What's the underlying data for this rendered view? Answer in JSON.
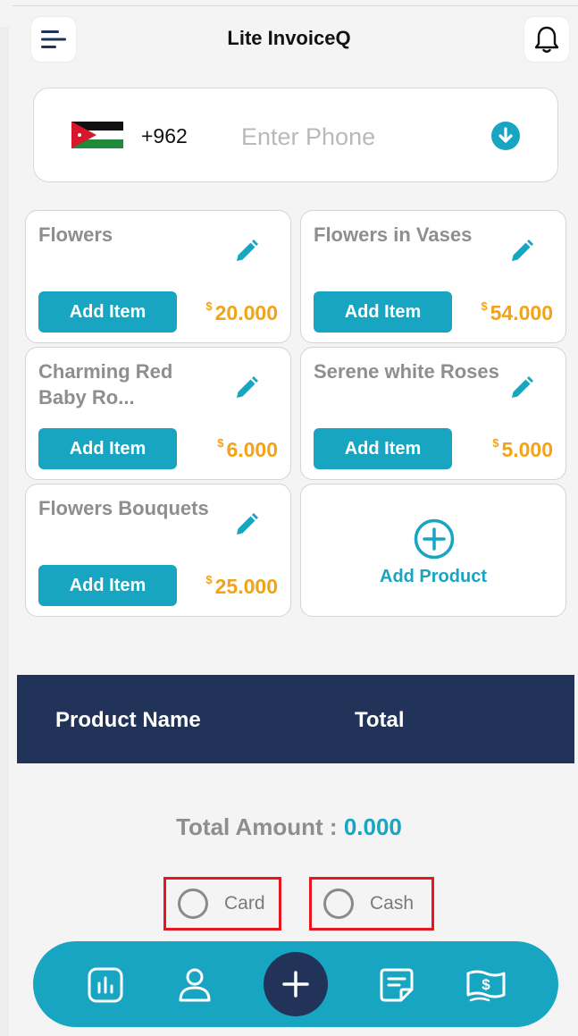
{
  "header": {
    "title": "Lite InvoiceQ",
    "menu_icon": "menu-icon",
    "bell_icon": "bell-icon"
  },
  "phone": {
    "country_code": "+962",
    "placeholder": "Enter Phone",
    "value": "",
    "flag": "jordan-flag",
    "dropdown_icon": "arrow-down-circle-icon"
  },
  "products": [
    {
      "name": "Flowers",
      "price": "20.000",
      "currency_symbol": "$",
      "button": "Add Item"
    },
    {
      "name": "Flowers in Vases",
      "price": "54.000",
      "currency_symbol": "$",
      "button": "Add Item"
    },
    {
      "name": "Charming Red Baby Ro...",
      "price": "6.000",
      "currency_symbol": "$",
      "button": "Add Item"
    },
    {
      "name": "Serene white Roses",
      "price": "5.000",
      "currency_symbol": "$",
      "button": "Add Item"
    },
    {
      "name": "Flowers Bouquets",
      "price": "25.000",
      "currency_symbol": "$",
      "button": "Add Item"
    }
  ],
  "add_product": {
    "label": "Add Product"
  },
  "table": {
    "col_name": "Product Name",
    "col_total": "Total"
  },
  "totals": {
    "label": "Total Amount  :",
    "value": "0.000"
  },
  "payment": {
    "options": [
      {
        "label": "Card",
        "selected": false
      },
      {
        "label": "Cash",
        "selected": false
      }
    ]
  },
  "nav": [
    "chart-icon",
    "user-icon",
    "plus-icon",
    "invoice-icon",
    "money-icon"
  ],
  "colors": {
    "accent": "#17a5c2",
    "navy": "#22335a",
    "price": "#f2a318",
    "highlight": "#e5181f"
  }
}
